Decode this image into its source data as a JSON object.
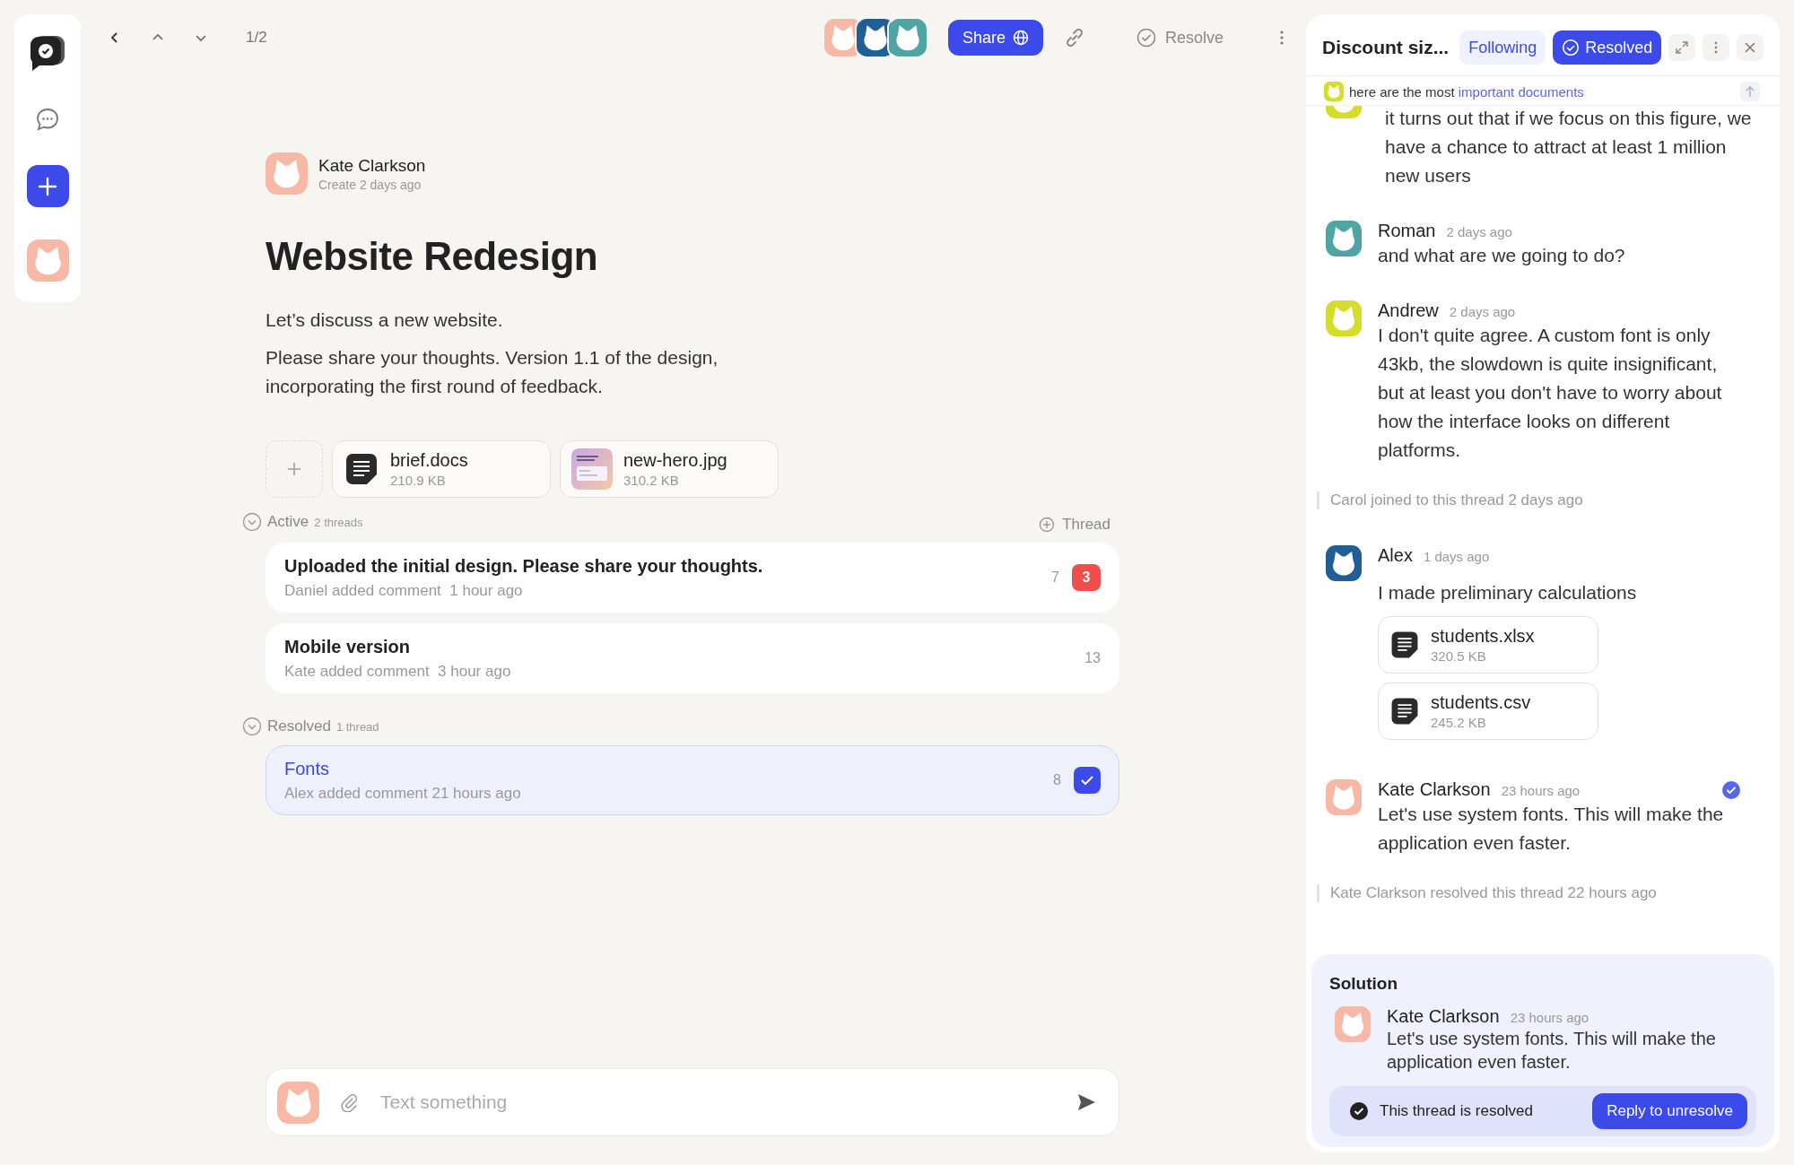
{
  "nav": {
    "counter": "1/2"
  },
  "participants": [
    {
      "color": "#f7b9a6"
    },
    {
      "color": "#1f5f96"
    },
    {
      "color": "#4fa5a3"
    }
  ],
  "toolbar": {
    "share": "Share",
    "resolve": "Resolve"
  },
  "post": {
    "author": "Kate Clarkson",
    "meta": "Create 2 days ago",
    "title": "Website Redesign",
    "paragraphs": [
      "Let’s discuss a new website.",
      "Please share your thoughts. Version 1.1 of the design, incorporating the first round of feedback."
    ],
    "attachments": [
      {
        "kind": "doc",
        "name": "brief.docs",
        "size": "210.9 KB"
      },
      {
        "name": "new-hero.jpg",
        "size": "310.2 KB"
      }
    ]
  },
  "new_thread": "Thread",
  "sections": [
    {
      "label": "Active",
      "count": "2 threads",
      "threads": [
        {
          "title": "Uploaded the initial design. Please share your thoughts.",
          "meta": "Daniel added comment  1 hour ago",
          "count": "7",
          "unread": "3",
          "resolved": false
        },
        {
          "title": "Mobile version",
          "meta": "Kate added comment  3 hour ago",
          "count": "13",
          "resolved": false
        }
      ]
    },
    {
      "label": "Resolved",
      "count": "1 thread",
      "threads": [
        {
          "title": "Fonts",
          "meta": "Alex added comment 21 hours ago",
          "count": "8",
          "resolved": true
        }
      ]
    }
  ],
  "composer": {
    "placeholder": "Text something"
  },
  "panel": {
    "title": "Discount siz...",
    "toggles": [
      {
        "label": "Following",
        "on": false
      },
      {
        "label": "Resolved",
        "on": true
      }
    ],
    "pinned": {
      "text": "here are the most",
      "link": "important documents"
    },
    "feed": [
      {
        "kind": "continued",
        "color": "#d6dc2a",
        "text": "it turns out that if we focus on this figure, we have a chance to attract at least 1 million new users"
      },
      {
        "kind": "message",
        "color": "#4fa5a3",
        "name": "Roman",
        "time": "2 days ago",
        "text": "and what are we going to do?"
      },
      {
        "kind": "message",
        "color": "#d6dc2a",
        "name": "Andrew",
        "time": "2 days ago",
        "text": "I don't quite agree. A custom font is only 43kb, the slowdown is quite insignificant, but at least you don't have to worry about how the interface looks on different platforms."
      },
      {
        "kind": "event",
        "text": "Carol joined to this thread",
        "time": "2 days ago"
      },
      {
        "kind": "message",
        "color": "#1f5f96",
        "name": "Alex",
        "time": "1 days ago",
        "text": "I made preliminary calculations",
        "attachments": [
          {
            "name": "students.xlsx",
            "size": "320.5 KB"
          },
          {
            "name": "students.csv",
            "size": "245.2 KB"
          }
        ]
      },
      {
        "kind": "message",
        "color": "#f7b9a6",
        "name": "Kate Clarkson",
        "time": "23 hours ago",
        "text": "Let's use system fonts. This will make the application even faster.",
        "solution": true
      },
      {
        "kind": "event",
        "text": "Kate Clarkson resolved this thread",
        "time": "22 hours ago"
      }
    ],
    "solution": {
      "title": "Solution",
      "name": "Kate Clarkson",
      "time": "23 hours ago",
      "text": "Let's use system fonts. This will make the application even faster.",
      "status": "This thread is resolved",
      "action": "Reply to unresolve"
    }
  }
}
